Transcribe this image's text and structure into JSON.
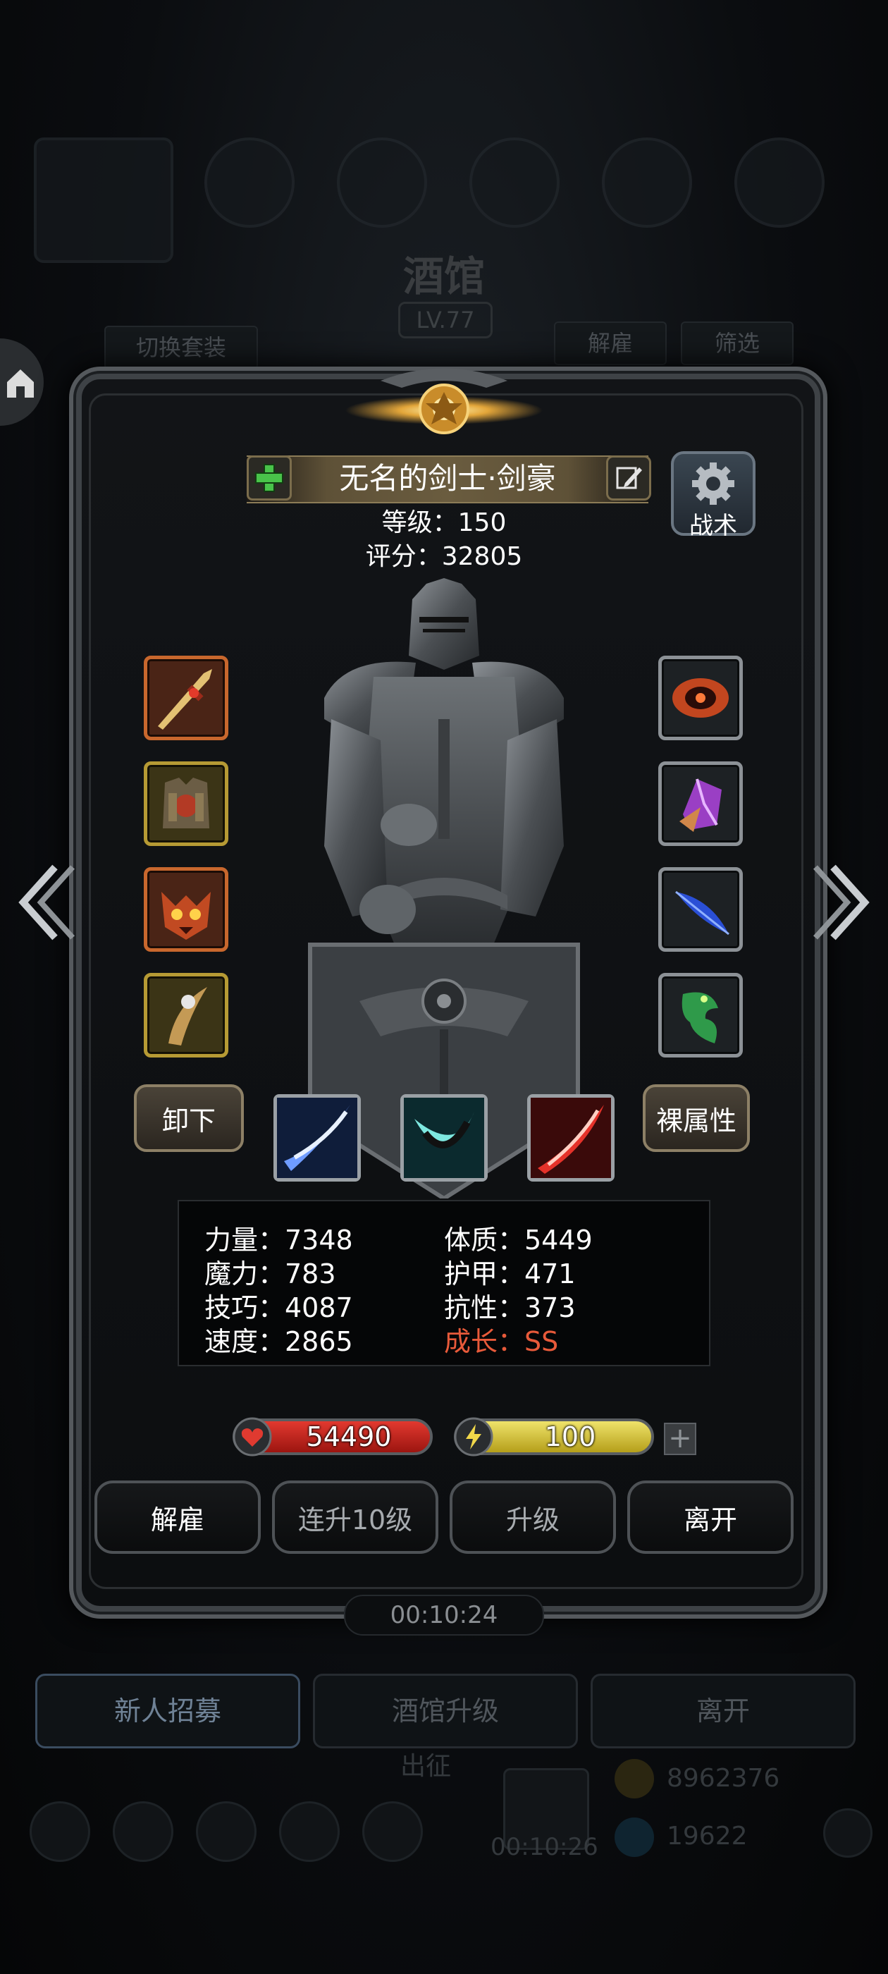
{
  "background": {
    "title": "酒馆",
    "level": "LV.77",
    "switch_outfit": "切换套装",
    "dismiss": "解雇",
    "filter": "筛选",
    "bottom_buttons": [
      "新人招募",
      "酒馆升级",
      "离开"
    ],
    "expedition": "出征",
    "timer": "00:10:26",
    "coins": "8962376",
    "gems": "19622"
  },
  "hero": {
    "name": "无名的剑士·剑豪",
    "level_text": "等级：150",
    "score_text": "评分：32805",
    "tactics_label": "战术"
  },
  "buttons": {
    "unequip": "卸下",
    "bare_attributes": "裸属性"
  },
  "attributes": {
    "left": [
      "力量：7348",
      "魔力：783",
      "技巧：4087",
      "速度：2865"
    ],
    "right": [
      "体质：5449",
      "护甲：471",
      "抗性：373",
      "成长：SS"
    ]
  },
  "resources": {
    "hp": "54490",
    "energy": "100",
    "add": "+"
  },
  "actions": {
    "dismiss": "解雇",
    "level_up_10": "连升10级",
    "level_up": "升级",
    "leave": "离开"
  },
  "timer": "00:10:24",
  "colors": {
    "highlight": "#e85a3a",
    "hp_bar": "#d12a22",
    "energy_bar": "#d9c73e",
    "gold_plate": "#6a5c3f"
  },
  "icons": {
    "left_slots": [
      "sword-icon",
      "chest-armor-icon",
      "demon-helmet-icon",
      "horn-dagger-icon"
    ],
    "right_slots": [
      "fire-eye-icon",
      "purple-crystal-icon",
      "blue-feather-icon",
      "green-dragon-icon"
    ],
    "skills": [
      "blue-slash-icon",
      "cyan-crescent-icon",
      "red-slash-icon"
    ]
  }
}
